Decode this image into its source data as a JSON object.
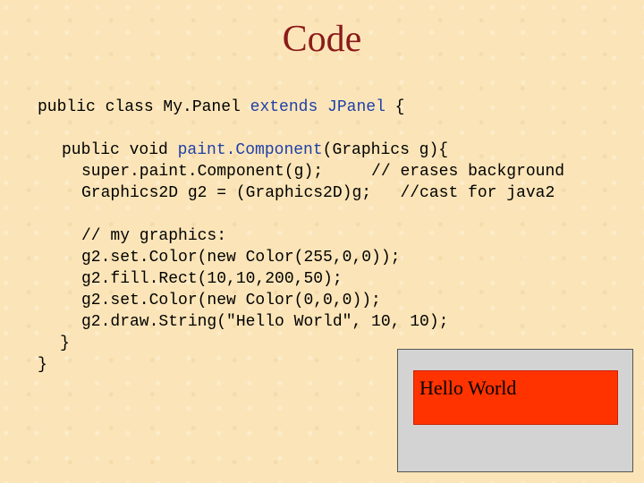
{
  "slide": {
    "title": "Code"
  },
  "code": {
    "l1_a": "public class My.Panel ",
    "l1_b": "extends JPanel",
    "l1_c": " {",
    "l2_a": "public void ",
    "l2_b": "paint.Component",
    "l2_c": "(Graphics g){",
    "l3": "super.paint.Component(g);     // erases background",
    "l4": "Graphics2D g2 = (Graphics2D)g;   //cast for java2",
    "l5": "// my graphics:",
    "l6": "g2.set.Color(new Color(255,0,0));",
    "l7": "g2.fill.Rect(10,10,200,50);",
    "l8": "g2.set.Color(new Color(0,0,0));",
    "l9": "g2.draw.String(\"Hello World\", 10, 10);",
    "l10": "}",
    "l11": "}"
  },
  "demo": {
    "output_text": "Hello World",
    "background_color": "#d3d3d3",
    "rect_color": "#ff3300"
  }
}
